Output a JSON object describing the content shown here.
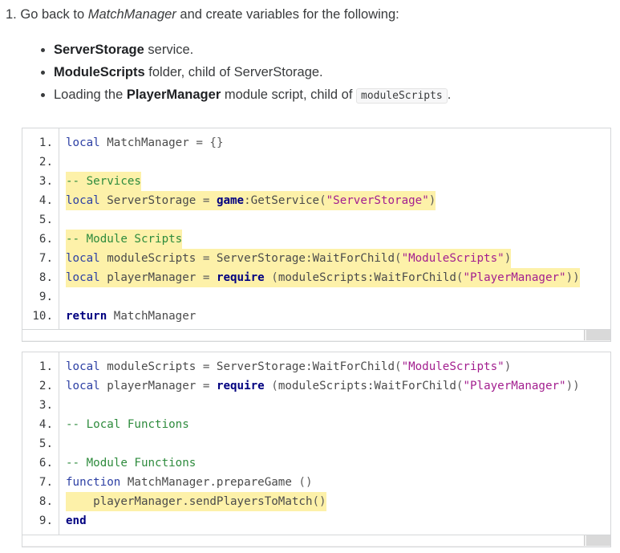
{
  "step": {
    "number": "1.",
    "before": "Go back to ",
    "em": "MatchManager",
    "after": " and create variables for the following:"
  },
  "bullets": [
    {
      "bold": "ServerStorage",
      "rest": " service."
    },
    {
      "bold": "ModuleScripts",
      "rest": " folder, child of ServerStorage."
    },
    {
      "pre": "Loading the ",
      "bold": "PlayerManager",
      "mid": " module script, child of ",
      "code": "moduleScripts",
      "rest": "."
    }
  ],
  "code_blocks": [
    {
      "lines": [
        {
          "num": "1.",
          "highlight": false,
          "tokens": [
            [
              "kwl",
              "local"
            ],
            [
              "pl",
              " MatchManager "
            ],
            [
              "op",
              "="
            ],
            [
              "pl",
              " "
            ],
            [
              "op",
              "{}"
            ]
          ]
        },
        {
          "num": "2.",
          "highlight": false,
          "tokens": []
        },
        {
          "num": "3.",
          "highlight": true,
          "tokens": [
            [
              "cm",
              "-- Services"
            ]
          ]
        },
        {
          "num": "4.",
          "highlight": true,
          "tokens": [
            [
              "kwl",
              "local"
            ],
            [
              "pl",
              " ServerStorage "
            ],
            [
              "op",
              "="
            ],
            [
              "pl",
              " "
            ],
            [
              "kw",
              "game"
            ],
            [
              "pl",
              ":GetService"
            ],
            [
              "op",
              "("
            ],
            [
              "st",
              "\"ServerStorage\""
            ],
            [
              "op",
              ")"
            ]
          ]
        },
        {
          "num": "5.",
          "highlight": false,
          "tokens": []
        },
        {
          "num": "6.",
          "highlight": true,
          "tokens": [
            [
              "cm",
              "-- Module Scripts"
            ]
          ]
        },
        {
          "num": "7.",
          "highlight": true,
          "tokens": [
            [
              "kwl",
              "local"
            ],
            [
              "pl",
              " moduleScripts "
            ],
            [
              "op",
              "="
            ],
            [
              "pl",
              " ServerStorage:WaitForChild"
            ],
            [
              "op",
              "("
            ],
            [
              "st",
              "\"ModuleScripts\""
            ],
            [
              "op",
              ")"
            ]
          ]
        },
        {
          "num": "8.",
          "highlight": true,
          "tokens": [
            [
              "kwl",
              "local"
            ],
            [
              "pl",
              " playerManager "
            ],
            [
              "op",
              "="
            ],
            [
              "pl",
              " "
            ],
            [
              "kw",
              "require"
            ],
            [
              "op",
              " ("
            ],
            [
              "pl",
              "moduleScripts:WaitForChild"
            ],
            [
              "op",
              "("
            ],
            [
              "st",
              "\"PlayerManager\""
            ],
            [
              "op",
              "))"
            ]
          ]
        },
        {
          "num": "9.",
          "highlight": false,
          "tokens": []
        },
        {
          "num": "10.",
          "highlight": false,
          "tokens": [
            [
              "kw",
              "return"
            ],
            [
              "pl",
              " MatchManager"
            ]
          ]
        }
      ]
    },
    {
      "lines": [
        {
          "num": "1.",
          "highlight": false,
          "tokens": [
            [
              "kwl",
              "local"
            ],
            [
              "pl",
              " moduleScripts "
            ],
            [
              "op",
              "="
            ],
            [
              "pl",
              " ServerStorage:WaitForChild"
            ],
            [
              "op",
              "("
            ],
            [
              "st",
              "\"ModuleScripts\""
            ],
            [
              "op",
              ")"
            ]
          ]
        },
        {
          "num": "2.",
          "highlight": false,
          "tokens": [
            [
              "kwl",
              "local"
            ],
            [
              "pl",
              " playerManager "
            ],
            [
              "op",
              "="
            ],
            [
              "pl",
              " "
            ],
            [
              "kw",
              "require"
            ],
            [
              "op",
              " ("
            ],
            [
              "pl",
              "moduleScripts:WaitForChild"
            ],
            [
              "op",
              "("
            ],
            [
              "st",
              "\"PlayerManager\""
            ],
            [
              "op",
              "))"
            ]
          ]
        },
        {
          "num": "3.",
          "highlight": false,
          "tokens": []
        },
        {
          "num": "4.",
          "highlight": false,
          "tokens": [
            [
              "cm",
              "-- Local Functions"
            ]
          ]
        },
        {
          "num": "5.",
          "highlight": false,
          "tokens": []
        },
        {
          "num": "6.",
          "highlight": false,
          "tokens": [
            [
              "cm",
              "-- Module Functions"
            ]
          ]
        },
        {
          "num": "7.",
          "highlight": false,
          "tokens": [
            [
              "kwl",
              "function"
            ],
            [
              "pl",
              " MatchManager.prepareGame"
            ],
            [
              "op",
              " ()"
            ]
          ]
        },
        {
          "num": "8.",
          "highlight": true,
          "tokens": [
            [
              "pl",
              "    playerManager.sendPlayersToMatch"
            ],
            [
              "op",
              "()"
            ]
          ]
        },
        {
          "num": "9.",
          "highlight": false,
          "tokens": [
            [
              "kw",
              "end"
            ]
          ]
        }
      ]
    }
  ],
  "colors": {
    "highlight": "#fdf1a9",
    "keyword": "#000080",
    "local_keyword": "#2c3fa4",
    "comment": "#2e8b3d",
    "string": "#a31f8f"
  }
}
